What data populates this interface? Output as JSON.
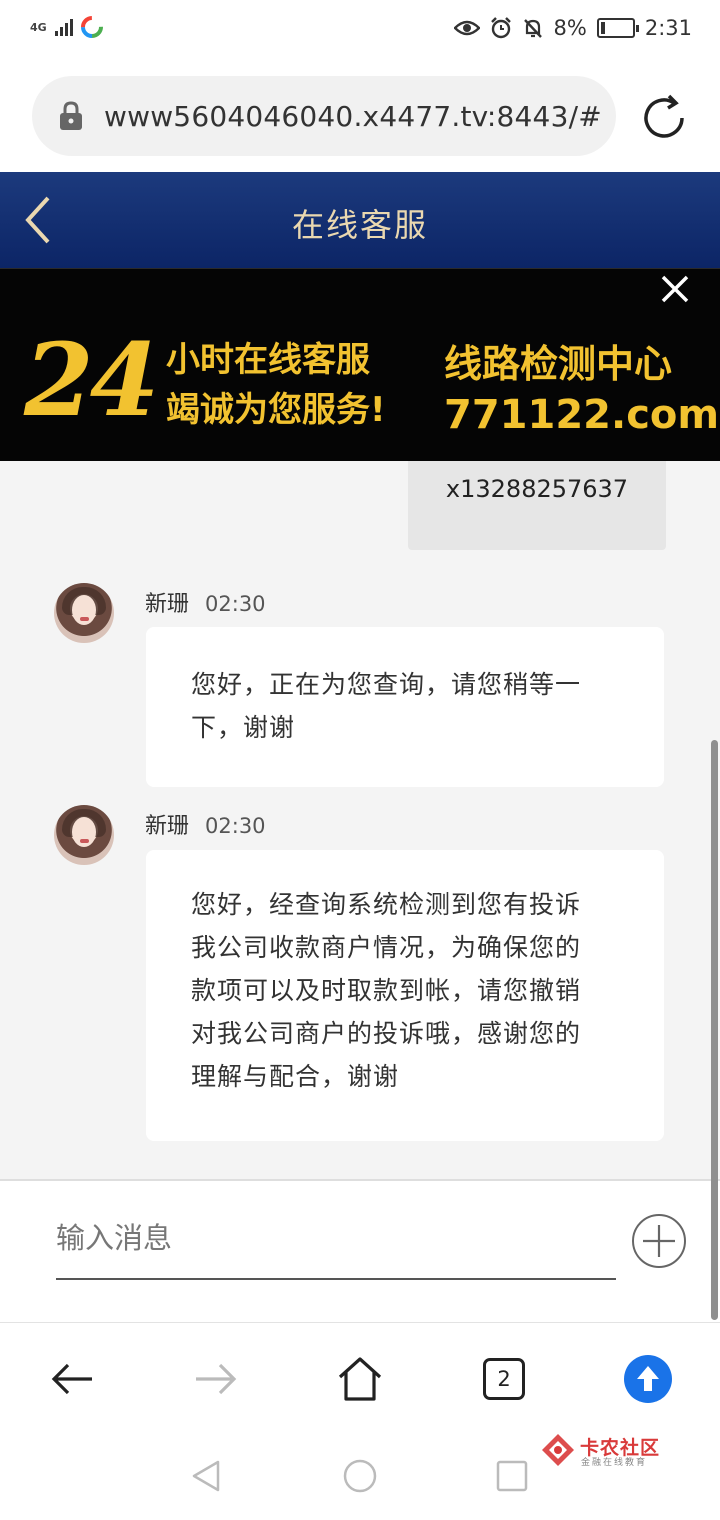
{
  "status_bar": {
    "network": "4G",
    "battery": "8%",
    "time": "2:31"
  },
  "browser": {
    "url": "www5604046040.x4477.tv:8443/#",
    "tab_count": "2"
  },
  "header": {
    "title": "在线客服"
  },
  "banner": {
    "number": "24",
    "line1": "小时在线客服",
    "line2": "竭诚为您服务!",
    "right_line1": "线路检测中心",
    "right_line2": "771122.com"
  },
  "chat": {
    "sent_message": "x13288257637",
    "messages": [
      {
        "name": "新珊",
        "time": "02:30",
        "lines": [
          "您好，正在为您查询，请您稍等一",
          "下，谢谢"
        ]
      },
      {
        "name": "新珊",
        "time": "02:30",
        "lines": [
          "您好，经查询系统检测到您有投诉",
          "我公司收款商户情况，为确保您的",
          "款项可以及时取款到帐，请您撤销",
          "对我公司商户的投诉哦，感谢您的",
          "理解与配合，谢谢"
        ]
      }
    ],
    "input_placeholder": "输入消息"
  },
  "watermark": {
    "title": "卡农社区",
    "subtitle": "金融在线教育"
  },
  "colors": {
    "header_blue": "#0c2566",
    "header_text": "#ead8b0",
    "banner_gold": "#f2c230",
    "chat_bg": "#f4f4f4",
    "upload_blue": "#1a73e8"
  },
  "icons": [
    "lock-icon",
    "reload-icon",
    "back-icon",
    "close-icon",
    "plus-icon",
    "arrow-left-icon",
    "arrow-right-icon",
    "home-icon",
    "upload-icon",
    "nav-back-icon",
    "nav-home-icon",
    "nav-recents-icon"
  ]
}
